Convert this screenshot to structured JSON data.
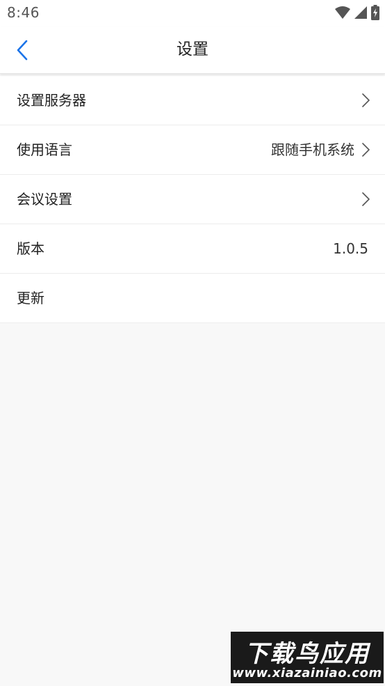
{
  "status_bar": {
    "time": "8:46",
    "icons": [
      "wifi-icon",
      "signal-icon",
      "battery-charging-icon"
    ]
  },
  "header": {
    "title": "设置",
    "back_icon": "chevron-left-icon",
    "accent_color": "#1a73e8"
  },
  "settings": {
    "items": [
      {
        "label": "设置服务器",
        "value": "",
        "chevron": true
      },
      {
        "label": "使用语言",
        "value": "跟随手机系统",
        "chevron": true
      },
      {
        "label": "会议设置",
        "value": "",
        "chevron": true
      },
      {
        "label": "版本",
        "value": "1.0.5",
        "chevron": false
      },
      {
        "label": "更新",
        "value": "",
        "chevron": false
      }
    ]
  },
  "watermark": {
    "title": "下载鸟应用",
    "url": "www.xiazainiao.com"
  }
}
